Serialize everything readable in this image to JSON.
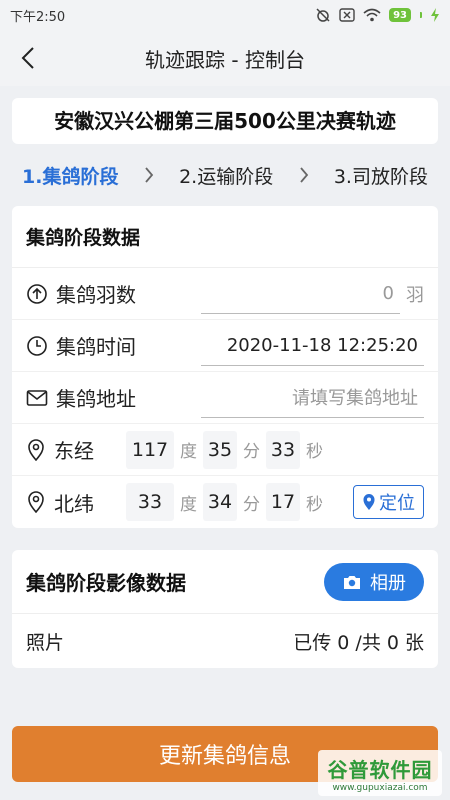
{
  "status_bar": {
    "time": "下午2:50",
    "battery": "93"
  },
  "topbar": {
    "title": "轨迹跟踪 - 控制台"
  },
  "race": {
    "title": "安徽汉兴公棚第三届500公里决赛轨迹"
  },
  "steps": [
    {
      "label": "1.集鸽阶段",
      "active": true
    },
    {
      "label": "2.运输阶段",
      "active": false
    },
    {
      "label": "3.司放阶段",
      "active": false
    }
  ],
  "gather": {
    "section_title": "集鸽阶段数据",
    "count_label": "集鸽羽数",
    "count_value": "0",
    "count_unit": "羽",
    "time_label": "集鸽时间",
    "time_value": "2020-11-18 12:25:20",
    "address_label": "集鸽地址",
    "address_placeholder": "请填写集鸽地址",
    "lon_label": "东经",
    "lon_deg": "117",
    "lon_min": "35",
    "lon_sec": "33",
    "lat_label": "北纬",
    "lat_deg": "33",
    "lat_min": "34",
    "lat_sec": "17",
    "unit_deg": "度",
    "unit_min": "分",
    "unit_sec": "秒",
    "locate_label": "定位"
  },
  "media": {
    "section_title": "集鸽阶段影像数据",
    "album_label": "相册",
    "photo_label": "照片",
    "photo_status": "已传 0 /共 0 张"
  },
  "actions": {
    "update_label": "更新集鸽信息"
  },
  "watermark": {
    "main": "谷普软件园",
    "sub": "www.gupuxiazai.com"
  },
  "colors": {
    "accent": "#2a6fd6",
    "button": "#e07f2f",
    "album": "#2a7be0"
  }
}
